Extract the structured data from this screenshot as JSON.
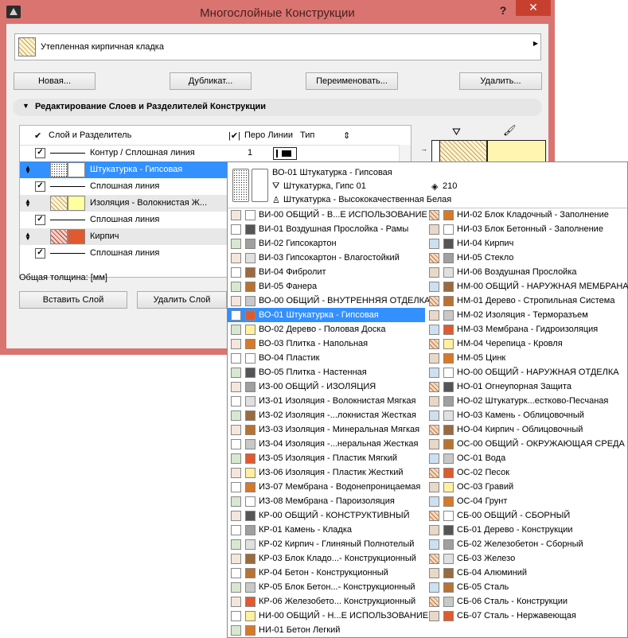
{
  "window": {
    "title": "Многослойные Конструкции",
    "help": "?",
    "close": "✕"
  },
  "composite": {
    "name": "Утепленная кирпичная кладка"
  },
  "buttons": {
    "new": "Новая...",
    "duplicate": "Дубликат...",
    "rename": "Переименовать...",
    "delete": "Удалить..."
  },
  "section": {
    "title": "Редактирование Слоев и Разделителей Конструкции"
  },
  "table": {
    "headers": {
      "layer": "Слой и Разделитель",
      "pen": "Перо Линии",
      "type": "Тип"
    },
    "rows": [
      {
        "kind": "line",
        "text": "Контур / Сплошная линия",
        "pen": "1"
      },
      {
        "kind": "layer",
        "text": "Штукатурка - Гипсовая",
        "selected": true
      },
      {
        "kind": "line",
        "text": "Сплошная линия"
      },
      {
        "kind": "layer",
        "text": "Изоляция - Волокнистая Ж..."
      },
      {
        "kind": "line",
        "text": "Сплошная линия"
      },
      {
        "kind": "layer",
        "text": "Кирпич"
      },
      {
        "kind": "line",
        "text": "Сплошная линия"
      }
    ]
  },
  "total_label": "Общая толщина: [мм]",
  "insert_layer": "Вставить Слой",
  "delete_layer": "Удалить Слой",
  "popup": {
    "header": {
      "name": "ВО-01 Штукатурка - Гипсовая",
      "cut_fill": "Штукатурка, Гипс 01",
      "cut_value": "210",
      "surface": "Штукатурка - Высококачественная Белая"
    },
    "left": [
      "ВИ-00 ОБЩИЙ - В...Е ИСПОЛЬЗОВАНИЕ",
      "ВИ-01 Воздушная Прослойка - Рамы",
      "ВИ-02 Гипсокартон",
      "ВИ-03 Гипсокартон - Влагостойкий",
      "ВИ-04 Фибролит",
      "ВИ-05 Фанера",
      "ВО-00 ОБЩИЙ - ВНУТРЕННЯЯ ОТДЕЛКА",
      "ВО-01 Штукатурка - Гипсовая",
      "ВО-02 Дерево - Половая Доска",
      "ВО-03 Плитка - Напольная",
      "ВО-04 Пластик",
      "ВО-05 Плитка - Настенная",
      "ИЗ-00 ОБЩИЙ - ИЗОЛЯЦИЯ",
      "ИЗ-01 Изоляция - Волокнистая Мягкая",
      "ИЗ-02 Изоляция -...локнистая Жесткая",
      "ИЗ-03 Изоляция - Минеральная Мягкая",
      "ИЗ-04 Изоляция -...неральная Жесткая",
      "ИЗ-05 Изоляция - Пластик Мягкий",
      "ИЗ-06 Изоляция - Пластик Жесткий",
      "ИЗ-07 Мембрана - Водонепроницаемая",
      "ИЗ-08 Мембрана - Пароизоляция",
      "КР-00 ОБЩИЙ - КОНСТРУКТИВНЫЙ",
      "КР-01 Камень - Кладка",
      "КР-02 Кирпич - Глиняный Полнотелый",
      "КР-03 Блок Кладо...- Конструкционный",
      "КР-04 Бетон - Конструкционный",
      "КР-05 Блок Бетон...- Конструкционный",
      "КР-06 Железобето... Конструкционный",
      "НИ-00 ОБЩИЙ - Н...Е ИСПОЛЬЗОВАНИЕ",
      "НИ-01 Бетон Легкий"
    ],
    "right": [
      "НИ-02 Блок Кладочный - Заполнение",
      "НИ-03 Блок Бетонный - Заполнение",
      "НИ-04 Кирпич",
      "НИ-05 Стекло",
      "НИ-06 Воздушная Прослойка",
      "НМ-00 ОБЩИЙ - НАРУЖНАЯ МЕМБРАНА",
      "НМ-01 Дерево - Стропильная Система",
      "НМ-02 Изоляция - Терморазъем",
      "НМ-03 Мембрана - Гидроизоляция",
      "НМ-04 Черепица - Кровля",
      "НМ-05 Цинк",
      "НО-00 ОБЩИЙ - НАРУЖНАЯ ОТДЕЛКА",
      "НО-01 Огнеупорная Защита",
      "НО-02 Штукатурк...естково-Песчаная",
      "НО-03 Камень - Облицовочный",
      "НО-04 Кирпич - Облицовочный",
      "ОС-00 ОБЩИЙ - ОКРУЖАЮЩАЯ СРЕДА",
      "ОС-01 Вода",
      "ОС-02 Песок",
      "ОС-03 Гравий",
      "ОС-04 Грунт",
      "СБ-00 ОБЩИЙ - СБОРНЫЙ",
      "СБ-01 Дерево - Конструкции",
      "СБ-02 Железобетон - Сборный",
      "СБ-03 Железо",
      "СБ-04 Алюминий",
      "СБ-05 Сталь",
      "СБ-06 Сталь - Конструкции",
      "СБ-07 Сталь - Нержавеющая"
    ],
    "selected": "ВО-01 Штукатурка - Гипсовая"
  },
  "colors": {
    "title_bar": "#d97470",
    "selection": "#3390ff",
    "close": "#c7402f"
  }
}
